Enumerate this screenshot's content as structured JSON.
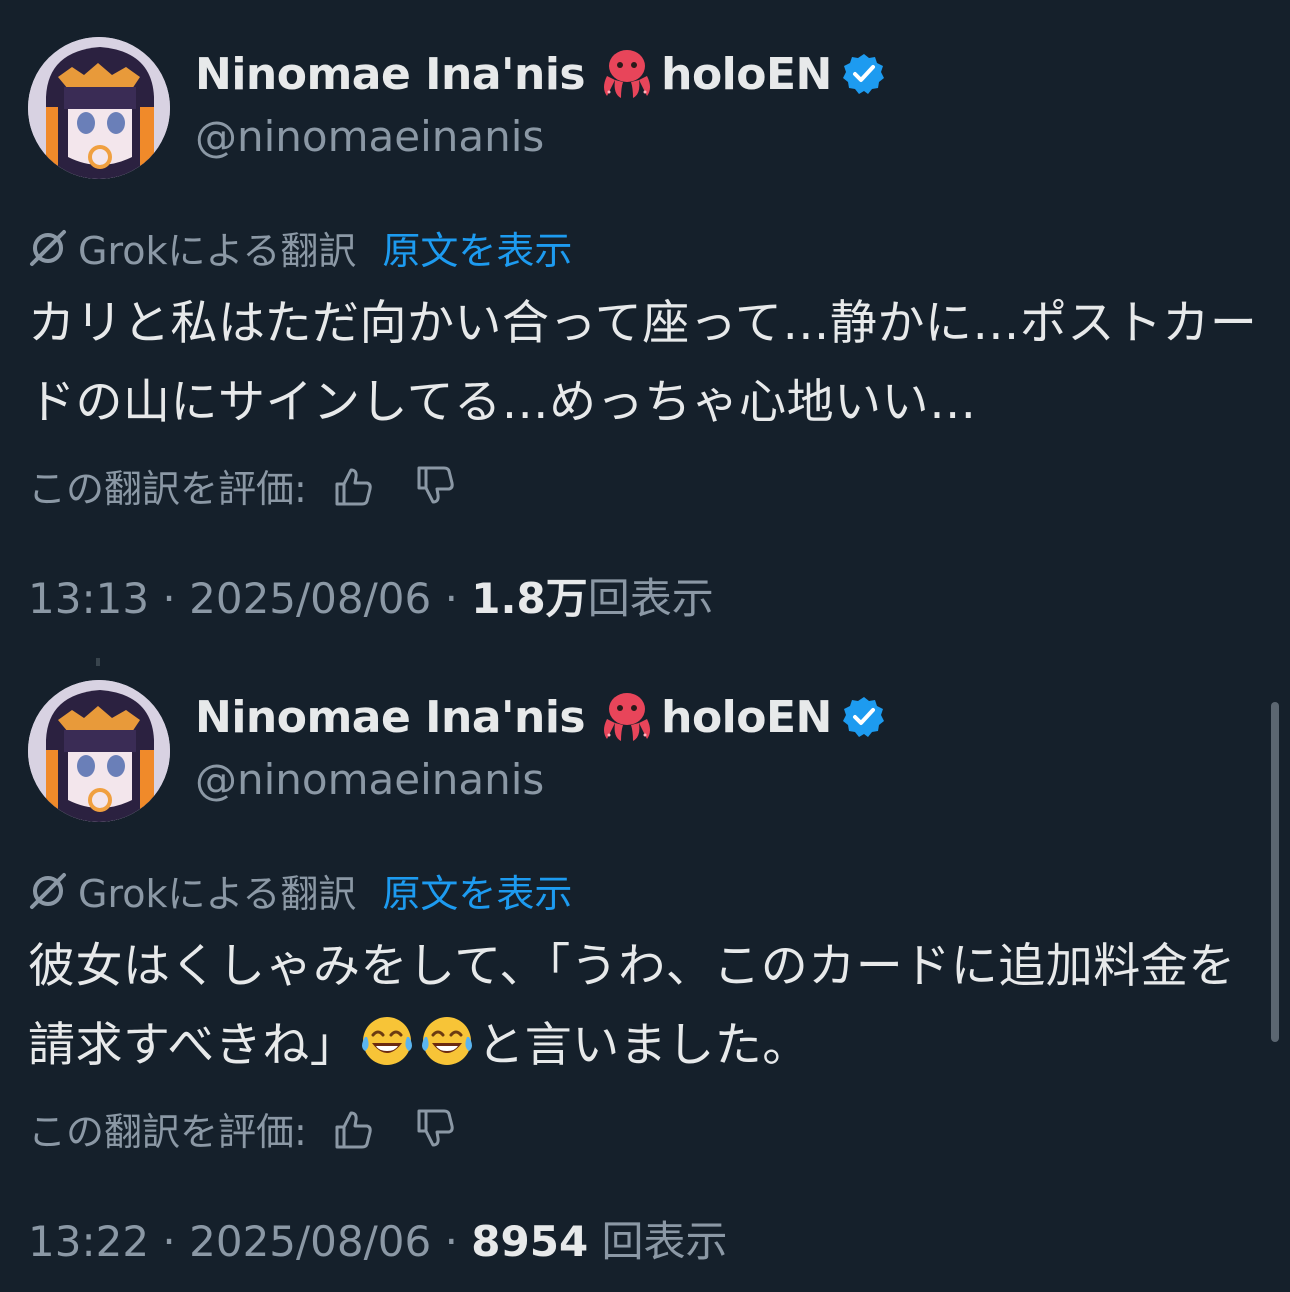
{
  "tweets": [
    {
      "display_name": "Ninomae Ina'nis",
      "name_suffix": "holoEN",
      "badge_icon": "octopus-emoji",
      "verified_icon": "verified-badge-icon",
      "handle": "@ninomaeinanis",
      "translation_label": "Grokによる翻訳",
      "show_original": "原文を表示",
      "body": "カリと私はただ向かい合って座って…静かに…ポストカードの山にサインしてる…めっちゃ心地いい…",
      "rate_label": "この翻訳を評価:",
      "time": "13:13",
      "date": "2025/08/06",
      "view_count": "1.8万",
      "view_label": "回表示"
    },
    {
      "display_name": "Ninomae Ina'nis",
      "name_suffix": "holoEN",
      "badge_icon": "octopus-emoji",
      "verified_icon": "verified-badge-icon",
      "handle": "@ninomaeinanis",
      "translation_label": "Grokによる翻訳",
      "show_original": "原文を表示",
      "body_before_emoji": "彼女はくしゃみをして、「うわ、このカードに追加料金を請求すべきね」",
      "body_emoji": "face-with-tears-of-joy",
      "body_after_emoji": "と言いました。",
      "rate_label": "この翻訳を評価:",
      "time": "13:22",
      "date": "2025/08/06",
      "view_count": "8954",
      "view_label": "回表示"
    }
  ],
  "separator": "·",
  "colors": {
    "background": "#15202b",
    "text": "#e7e9ea",
    "secondary": "#8b98a5",
    "link": "#1d9bf0",
    "verified": "#1d9bf0"
  }
}
